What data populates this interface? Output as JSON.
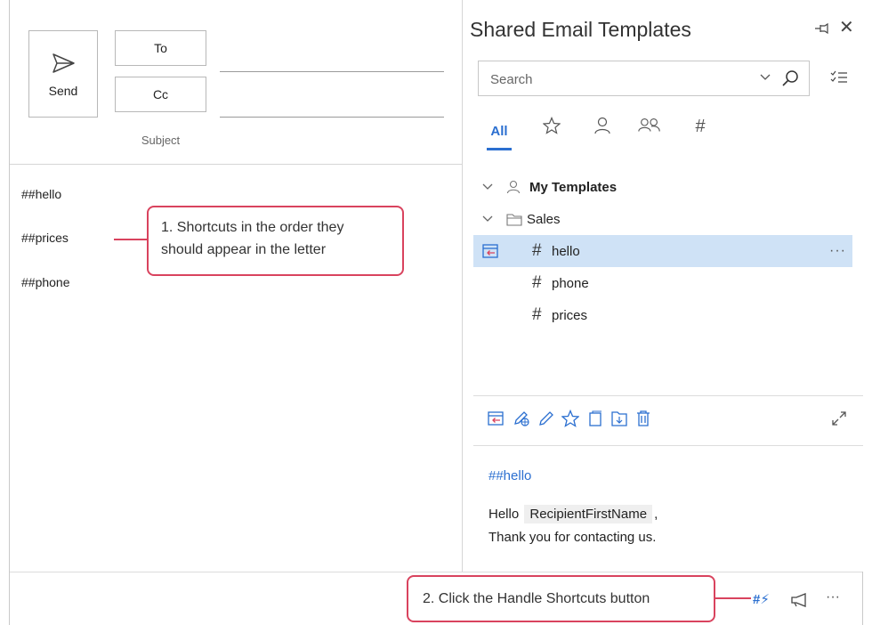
{
  "compose": {
    "send_label": "Send",
    "to_label": "To",
    "cc_label": "Cc",
    "subject_label": "Subject",
    "body_lines": [
      "##hello",
      "##prices",
      "##phone"
    ]
  },
  "callouts": {
    "first": "1. Shortcuts in the order they should appear in the letter",
    "second": "2. Click the Handle Shortcuts button"
  },
  "panel": {
    "title": "Shared Email Templates",
    "search_placeholder": "Search",
    "tabs": [
      "All",
      "star-icon",
      "person-icon",
      "people-icon",
      "#"
    ],
    "active_tab": "All",
    "tree": {
      "my_templates": "My Templates",
      "folder": "Sales",
      "hash": "#",
      "templates": [
        "hello",
        "phone",
        "prices"
      ],
      "selected": "hello",
      "more": "···"
    },
    "preview": {
      "title": "##hello",
      "greeting": "Hello",
      "macro": "RecipientFirstName",
      "after_macro": ",",
      "line2": "Thank you for contacting us."
    }
  },
  "footer": {
    "handle_shortcuts_icon": "#⚡",
    "more": "···"
  },
  "colors": {
    "accent": "#2b6fd0",
    "selection": "#cfe2f6",
    "callout_border": "#d9435e"
  }
}
